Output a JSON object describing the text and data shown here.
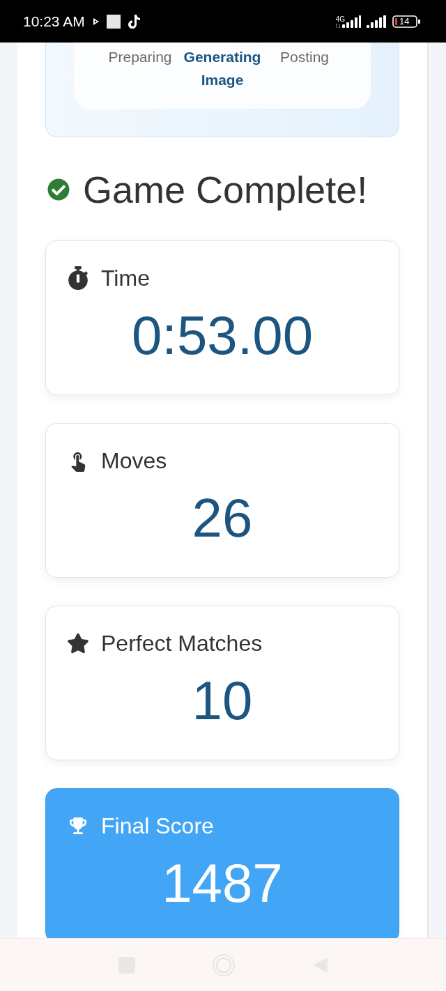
{
  "status_bar": {
    "time": "10:23 AM",
    "network": "4G",
    "battery": "14"
  },
  "progress": {
    "steps": [
      {
        "label": "Preparing",
        "selected": false
      },
      {
        "label": "Generating Image",
        "selected": true
      },
      {
        "label": "Posting",
        "selected": false
      }
    ]
  },
  "heading": "Game Complete!",
  "stats": [
    {
      "label": "Time",
      "value": "0:53.00",
      "highlighted": false
    },
    {
      "label": "Moves",
      "value": "26",
      "highlighted": false
    },
    {
      "label": "Perfect Matches",
      "value": "10",
      "highlighted": false
    },
    {
      "label": "Final Score",
      "value": "1487",
      "highlighted": true
    }
  ]
}
